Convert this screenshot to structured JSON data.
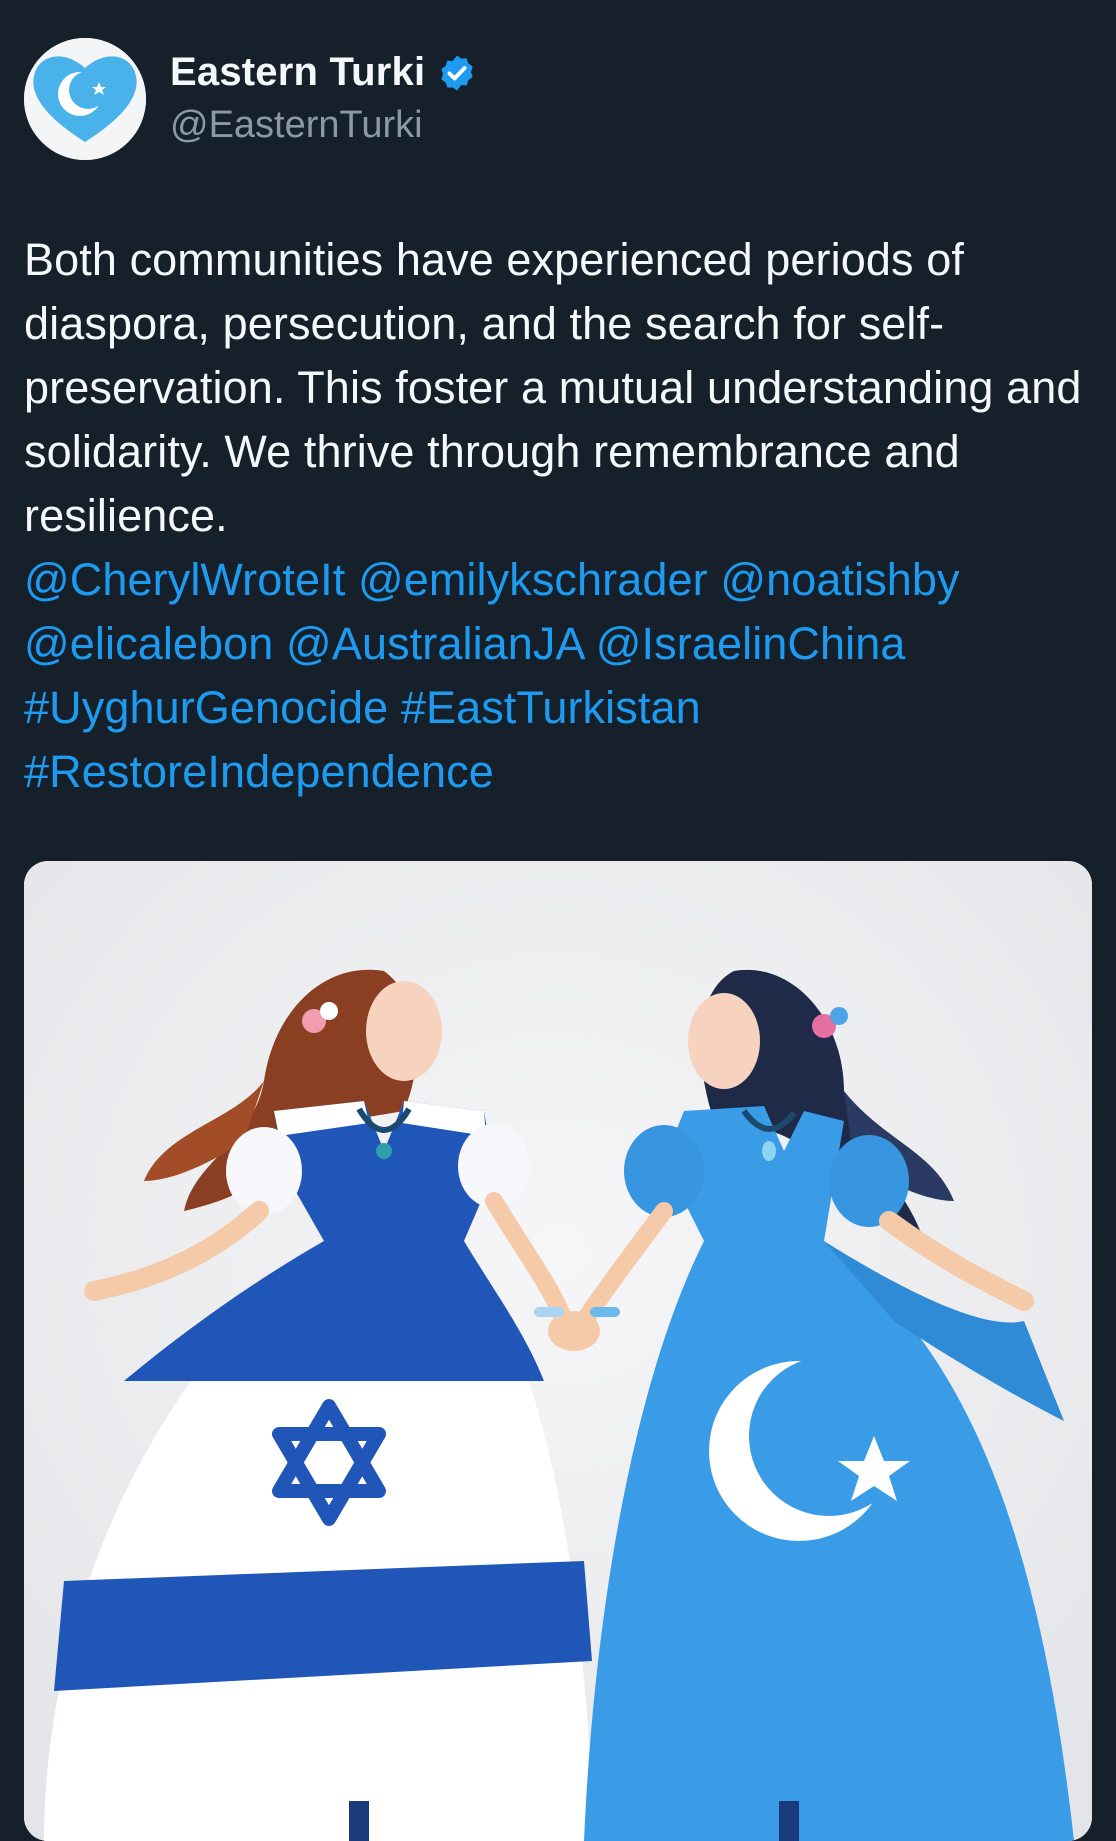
{
  "author": {
    "display_name": "Eastern Turki",
    "handle": "@EasternTurki",
    "verified_icon": "verified-badge-icon",
    "avatar_icon": "crescent-star-heart-icon"
  },
  "tweet": {
    "body": "Both communities have experienced periods of diaspora, persecution, and the search for self-preservation. This foster a mutual understanding and solidarity. We thrive through remembrance and resilience.",
    "mentions": [
      "@CherylWroteIt",
      "@emilykschrader",
      "@noatishby",
      "@elicalebon",
      "@AustralianJA",
      "@IsraelinChina"
    ],
    "hashtags": [
      "#UyghurGenocide",
      "#EastTurkistan",
      "#RestoreIndependence"
    ]
  },
  "media": {
    "kind": "illustration",
    "icons": [
      "star-of-david-icon",
      "crescent-star-icon"
    ]
  },
  "colors": {
    "background": "#15202b",
    "text": "#f5f8fa",
    "secondary_text": "#8b98a5",
    "link": "#1d9bf0",
    "israel_blue": "#1f56b8",
    "turkistan_blue": "#3a9be6"
  }
}
